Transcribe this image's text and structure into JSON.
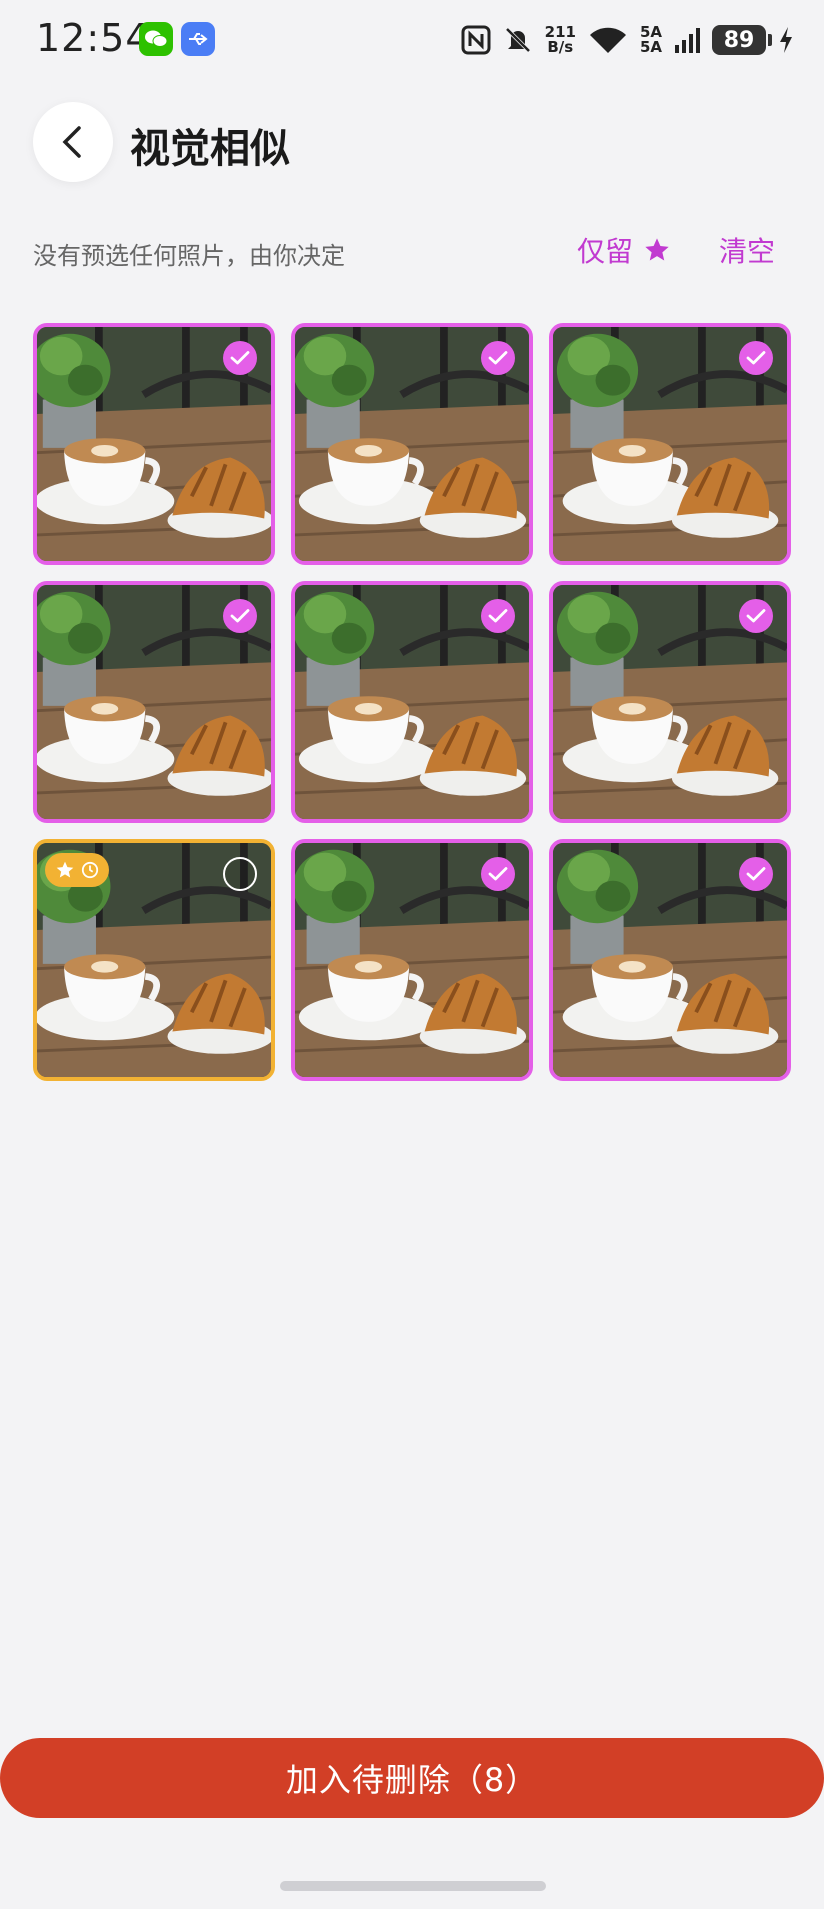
{
  "status_bar": {
    "time": "12:54",
    "net_speed_top": "211",
    "net_speed_bottom": "B/s",
    "signal_top": "5A",
    "signal_bottom": "5A",
    "battery": "89"
  },
  "header": {
    "title": "视觉相似"
  },
  "toolbar": {
    "hint": "没有预选任何照片，由你决定",
    "keep_starred_label": "仅留",
    "clear_label": "清空"
  },
  "photos": [
    {
      "selected": true,
      "starred": false
    },
    {
      "selected": true,
      "starred": false
    },
    {
      "selected": true,
      "starred": false
    },
    {
      "selected": true,
      "starred": false
    },
    {
      "selected": true,
      "starred": false
    },
    {
      "selected": true,
      "starred": false
    },
    {
      "selected": false,
      "starred": true
    },
    {
      "selected": true,
      "starred": false
    },
    {
      "selected": true,
      "starred": false
    }
  ],
  "footer": {
    "delete_button": "加入待删除（8）"
  },
  "colors": {
    "accent": "#c13ad0",
    "selected_border": "#e45fe8",
    "starred_border": "#f2b233",
    "primary_button": "#d23f26"
  }
}
